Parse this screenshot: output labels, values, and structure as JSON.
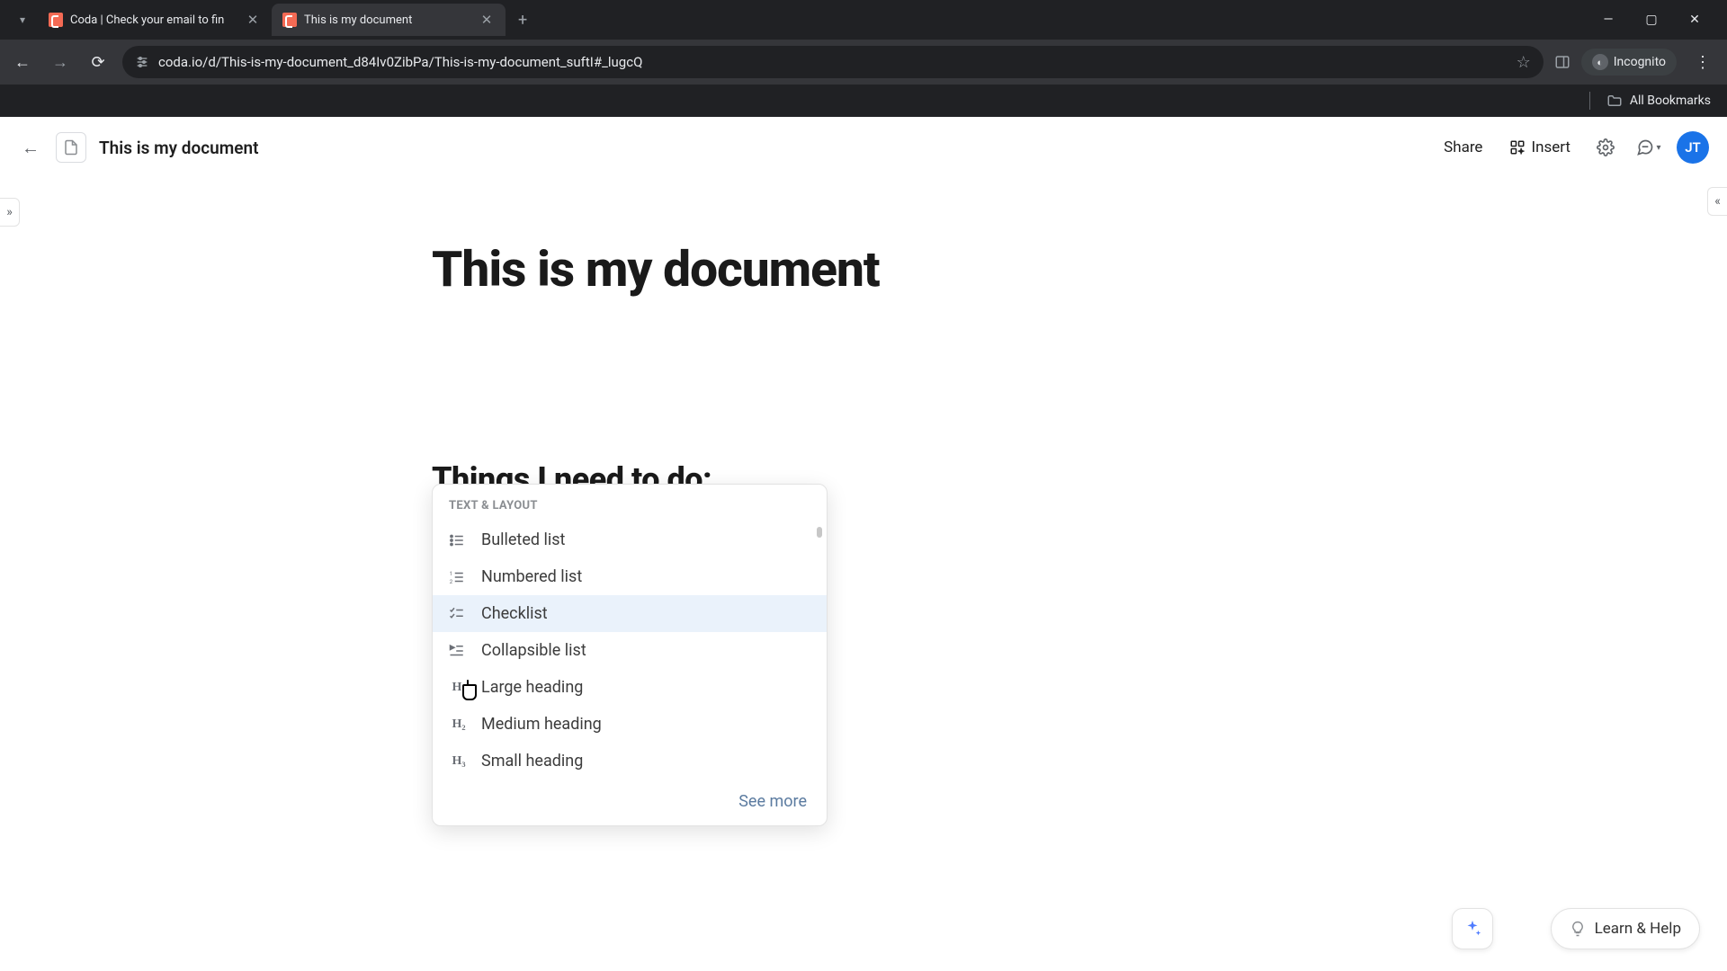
{
  "browser": {
    "tabs": [
      {
        "title": "Coda | Check your email to fin"
      },
      {
        "title": "This is my document"
      }
    ],
    "url": "coda.io/d/This-is-my-document_d84Iv0ZibPa/This-is-my-document_suftI#_lugcQ",
    "incognito_label": "Incognito",
    "bookmarks_label": "All Bookmarks"
  },
  "app_header": {
    "doc_title": "This is my document",
    "share_label": "Share",
    "insert_label": "Insert",
    "avatar_initials": "JT"
  },
  "page": {
    "title": "This is my document",
    "section_heading": "Things I need to do:",
    "slash_text": "/"
  },
  "slash_menu": {
    "section_label": "TEXT & LAYOUT",
    "items": [
      {
        "icon": "bulleted-list-icon",
        "label": "Bulleted list"
      },
      {
        "icon": "numbered-list-icon",
        "label": "Numbered list"
      },
      {
        "icon": "checklist-icon",
        "label": "Checklist"
      },
      {
        "icon": "collapsible-list-icon",
        "label": "Collapsible list"
      },
      {
        "icon": "h1-icon",
        "label": "Large heading"
      },
      {
        "icon": "h2-icon",
        "label": "Medium heading"
      },
      {
        "icon": "h3-icon",
        "label": "Small heading"
      }
    ],
    "highlighted_index": 2,
    "see_more_label": "See more"
  },
  "floating": {
    "help_label": "Learn & Help"
  }
}
